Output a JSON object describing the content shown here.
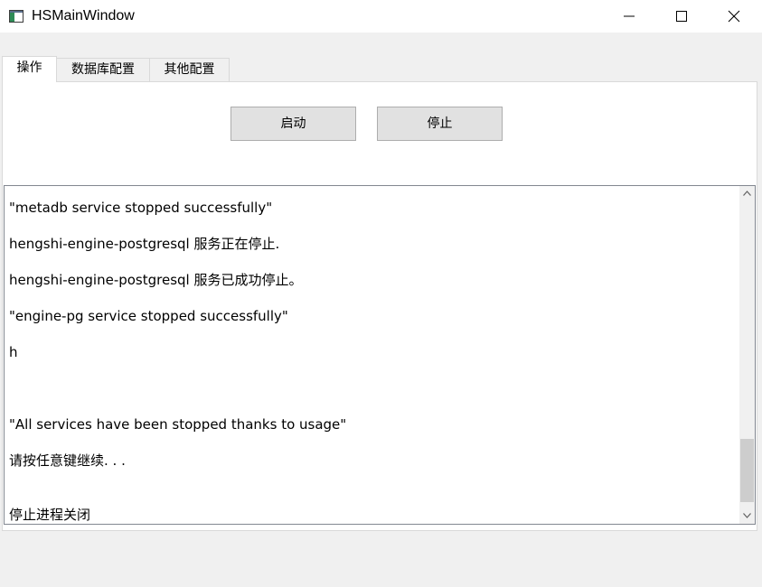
{
  "window": {
    "title": "HSMainWindow"
  },
  "tabs": [
    {
      "label": "操作",
      "active": true
    },
    {
      "label": "数据库配置",
      "active": false
    },
    {
      "label": "其他配置",
      "active": false
    }
  ],
  "actions": {
    "start_label": "启动",
    "stop_label": "停止"
  },
  "log": {
    "lines": [
      "\"metadb service stopped successfully\"",
      "hengshi-engine-postgresql 服务正在停止.",
      "hengshi-engine-postgresql 服务已成功停止。",
      "\"engine-pg service stopped successfully\"",
      "h",
      "",
      "\"All services have been stopped thanks to usage\"",
      "请按任意键继续. . .",
      "",
      "停止进程关闭"
    ]
  },
  "icons": {
    "app": "window-app-icon",
    "minimize": "minimize-icon",
    "maximize": "maximize-icon",
    "close": "close-icon",
    "scroll_up": "chevron-up-icon",
    "scroll_down": "chevron-down-icon"
  }
}
